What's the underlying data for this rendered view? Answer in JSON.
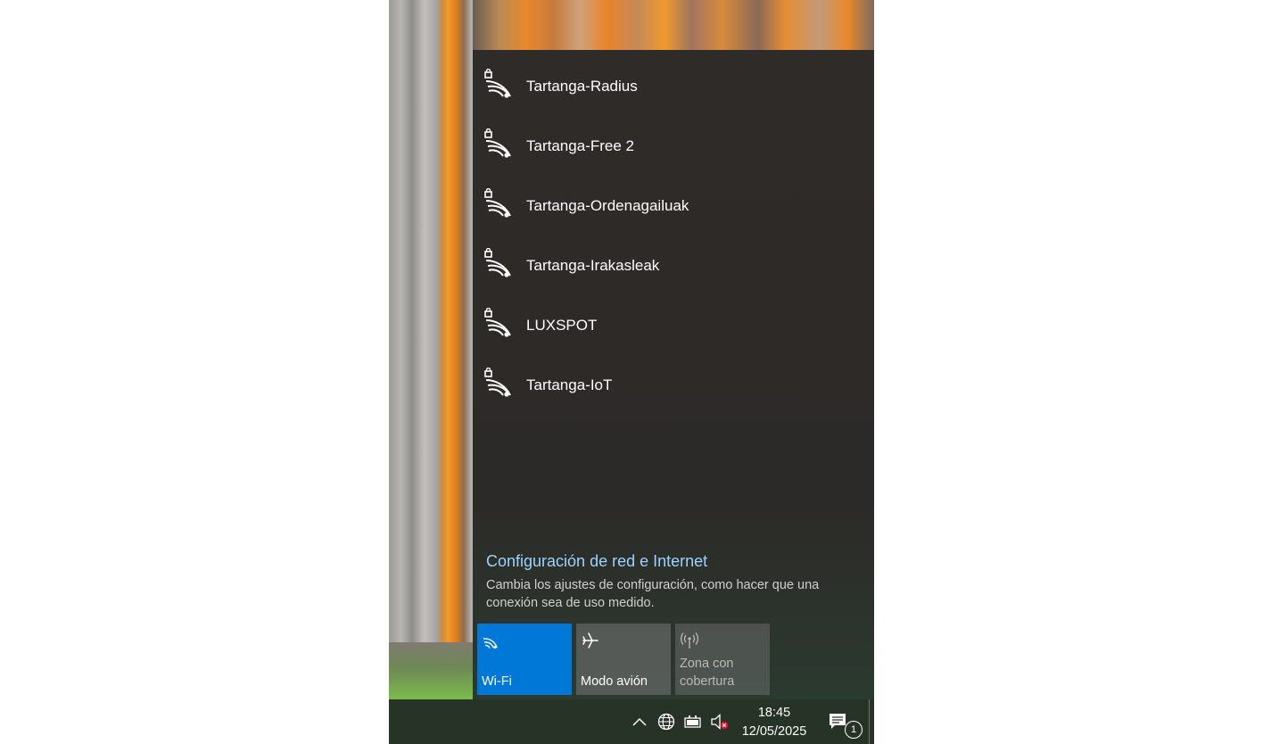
{
  "networks": [
    {
      "name": "Tartanga-Radius",
      "icon": "wifi-secured-icon"
    },
    {
      "name": "Tartanga-Free 2",
      "icon": "wifi-secured-icon"
    },
    {
      "name": "Tartanga-Ordenagailuak",
      "icon": "wifi-secured-icon"
    },
    {
      "name": "Tartanga-Irakasleak",
      "icon": "wifi-secured-icon"
    },
    {
      "name": "LUXSPOT",
      "icon": "wifi-secured-icon"
    },
    {
      "name": "Tartanga-IoT",
      "icon": "wifi-secured-icon"
    }
  ],
  "settings": {
    "link": "Configuración de red e Internet",
    "description": "Cambia los ajustes de configuración, como hacer que una conexión sea de uso medido."
  },
  "quick_actions": {
    "wifi": {
      "label": "Wi-Fi",
      "active": true,
      "color": "#0078d7"
    },
    "airplane": {
      "label": "Modo avión",
      "active": false
    },
    "hotspot": {
      "label": "Zona con cobertura",
      "active": false
    }
  },
  "taskbar": {
    "time": "18:45",
    "date": "12/05/2025",
    "notification_count": "1",
    "tray_icons": [
      "chevron-up-icon",
      "globe-network-icon",
      "battery-icon",
      "volume-muted-icon"
    ]
  },
  "colors": {
    "accent": "#0078d7",
    "link": "#99d3ff",
    "muted_badge": "#e81123"
  }
}
